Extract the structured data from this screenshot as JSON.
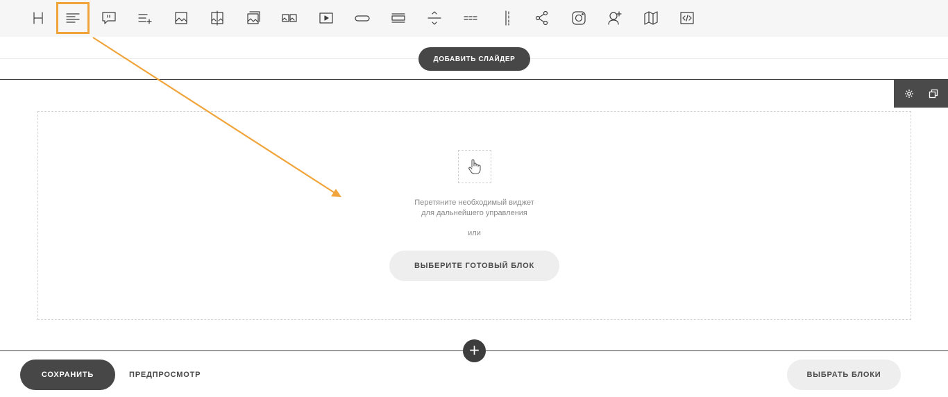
{
  "toolbar": {
    "tools": [
      {
        "name": "heading-tool",
        "icon": "heading-icon"
      },
      {
        "name": "text-tool",
        "icon": "text-align-left-icon",
        "active": true
      },
      {
        "name": "quote-tool",
        "icon": "quote-icon"
      },
      {
        "name": "list-tool",
        "icon": "list-add-icon"
      },
      {
        "name": "image-tool",
        "icon": "image-icon"
      },
      {
        "name": "image-compare-tool",
        "icon": "image-compare-icon"
      },
      {
        "name": "gallery-tool",
        "icon": "gallery-icon"
      },
      {
        "name": "image-grid-tool",
        "icon": "image-grid-icon"
      },
      {
        "name": "video-tool",
        "icon": "video-play-icon"
      },
      {
        "name": "button-tool",
        "icon": "button-pill-icon"
      },
      {
        "name": "block-tool",
        "icon": "block-lines-icon"
      },
      {
        "name": "spacer-tool",
        "icon": "spacer-icon"
      },
      {
        "name": "divider-tool",
        "icon": "divider-icon"
      },
      {
        "name": "columns-tool",
        "icon": "vertical-divider-icon"
      },
      {
        "name": "share-tool",
        "icon": "share-icon"
      },
      {
        "name": "instagram-tool",
        "icon": "instagram-icon"
      },
      {
        "name": "author-tool",
        "icon": "add-user-icon"
      },
      {
        "name": "map-tool",
        "icon": "map-icon"
      },
      {
        "name": "code-tool",
        "icon": "code-icon"
      }
    ]
  },
  "slider": {
    "add_label": "ДОБАВИТЬ СЛАЙДЕР"
  },
  "dropzone": {
    "hint_line1": "Перетяните необходимый виджет",
    "hint_line2": "для дальнейшего управления",
    "or_label": "или",
    "choose_block_label": "ВЫБЕРИТЕ ГОТОВЫЙ БЛОК"
  },
  "section": {
    "add_symbol": "+"
  },
  "footer": {
    "save_label": "СОХРАНИТЬ",
    "preview_label": "ПРЕДПРОСМОТР",
    "choose_blocks_label": "ВЫБРАТЬ БЛОКИ"
  },
  "colors": {
    "accent": "#f0a43a",
    "dark": "#474747",
    "toolbar_bg": "#f6f6f6",
    "light_button": "#eeeeee"
  }
}
